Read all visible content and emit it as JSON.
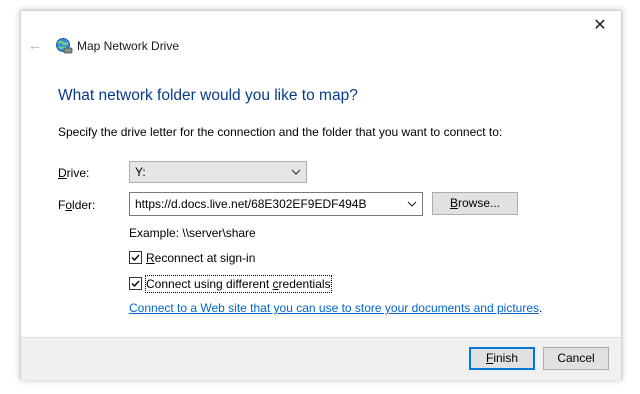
{
  "window": {
    "title": "Map Network Drive",
    "close_glyph": "✕",
    "back_glyph": "←"
  },
  "heading": "What network folder would you like to map?",
  "description": "Specify the drive letter for the connection and the folder that you want to connect to:",
  "drive": {
    "label_mnemonic": "D",
    "label_rest": "rive:",
    "value": "Y:"
  },
  "folder": {
    "label_first": "F",
    "label_mnemonic": "o",
    "label_rest": "lder:",
    "value": "https://d.docs.live.net/68E302EF9EDF494B",
    "browse_mnemonic": "B",
    "browse_rest": "rowse..."
  },
  "example": "Example: \\\\server\\share",
  "reconnect": {
    "checked": true,
    "label_mnemonic": "R",
    "label_rest": "econnect at sign-in"
  },
  "credentials": {
    "checked": true,
    "label_first": "Connect using different ",
    "label_mnemonic": "c",
    "label_rest": "redentials"
  },
  "link": "Connect to a Web site that you can use to store your documents and pictures",
  "link_suffix": ".",
  "buttons": {
    "finish_mnemonic": "F",
    "finish_rest": "inish",
    "cancel": "Cancel"
  },
  "colors": {
    "heading": "#0a3b8a",
    "link": "#0066cc",
    "default_button_border": "#0078d7",
    "footer": "#f0f0f0"
  }
}
